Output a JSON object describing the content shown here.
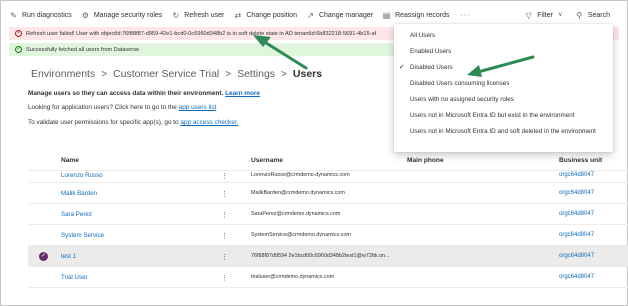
{
  "toolbar": {
    "items": [
      {
        "icon": "run-diagnostics-icon",
        "label": "Run diagnostics"
      },
      {
        "icon": "manage-security-roles-icon",
        "label": "Manage security roles"
      },
      {
        "icon": "refresh-icon",
        "label": "Refresh user"
      },
      {
        "icon": "change-position-icon",
        "label": "Change position"
      },
      {
        "icon": "change-manager-icon",
        "label": "Change manager"
      },
      {
        "icon": "reassign-records-icon",
        "label": "Reassign records"
      }
    ],
    "more": "···",
    "filter": "Filter",
    "search": "Search"
  },
  "notifications": {
    "error": "Refresh user failed! User with objectId:76f88f87-d959-42e1-bcd0-0c6960d348b2 is in soft delete state in AD tenantId:6b832218-5691-4b15-af",
    "success": "Successfully fetched all users from Dataverse"
  },
  "breadcrumb": {
    "items": [
      "Environments",
      "Customer Service Trial",
      "Settings"
    ],
    "current": "Users",
    "separator": ">"
  },
  "info": {
    "line1_bold": "Manage users so they can access data within their environment.",
    "line1_link": "Learn more",
    "line2_text": "Looking for application users? Click here to go to the",
    "line2_link": "app users list",
    "line3_text": "To validate user permissions for specific app(s), go to",
    "line3_link": "app access checker."
  },
  "table": {
    "columns": {
      "name": "Name",
      "username": "Username",
      "phone": "Main phone",
      "bu": "Business unit"
    },
    "rows": [
      {
        "name": "Lorenzo Russo",
        "username": "LorenzoRusso@crmdemo.dynamics.com",
        "bu": "orgc64d8047",
        "selected": false
      },
      {
        "name": "Malik Barden",
        "username": "MalikBarden@crmdemo.dynamics.com",
        "bu": "orgc64d8047",
        "selected": false
      },
      {
        "name": "Sara Perez",
        "username": "SaraPerez@crmdemo.dynamics.com",
        "bu": "orgc64d8047",
        "selected": false
      },
      {
        "name": "System Service",
        "username": "SystemService@crmdemo.dynamics.com",
        "bu": "orgc64d8047",
        "selected": false
      },
      {
        "name": "test 1",
        "username": "76f88f87d9594 2e1bcd00c6960d348b2test1@w72ttk.on...",
        "bu": "orgc64d8047",
        "selected": true
      },
      {
        "name": "Trial User",
        "username": "trialuser@crmdemo.dynamics.com",
        "bu": "orgc64d8047",
        "selected": false
      }
    ]
  },
  "filter_menu": {
    "items": [
      {
        "label": "All Users",
        "checked": false
      },
      {
        "label": "Enabled Users",
        "checked": false
      },
      {
        "label": "Disabled Users",
        "checked": true
      },
      {
        "label": "Disabled Users consuming licenses",
        "checked": false
      },
      {
        "label": "Users with no assigned security roles",
        "checked": false
      },
      {
        "label": "Users not in Microsoft Entra ID but exist in the environment",
        "checked": false
      },
      {
        "label": "Users not in Microsoft Entra ID and soft deleted in the environment",
        "checked": false
      }
    ]
  },
  "colors": {
    "accent": "#0f6cbd",
    "error_bg": "#fde7e9",
    "success_bg": "#dff6dd",
    "arrow": "#2e8b57",
    "selected_check": "#6b2a6e"
  }
}
